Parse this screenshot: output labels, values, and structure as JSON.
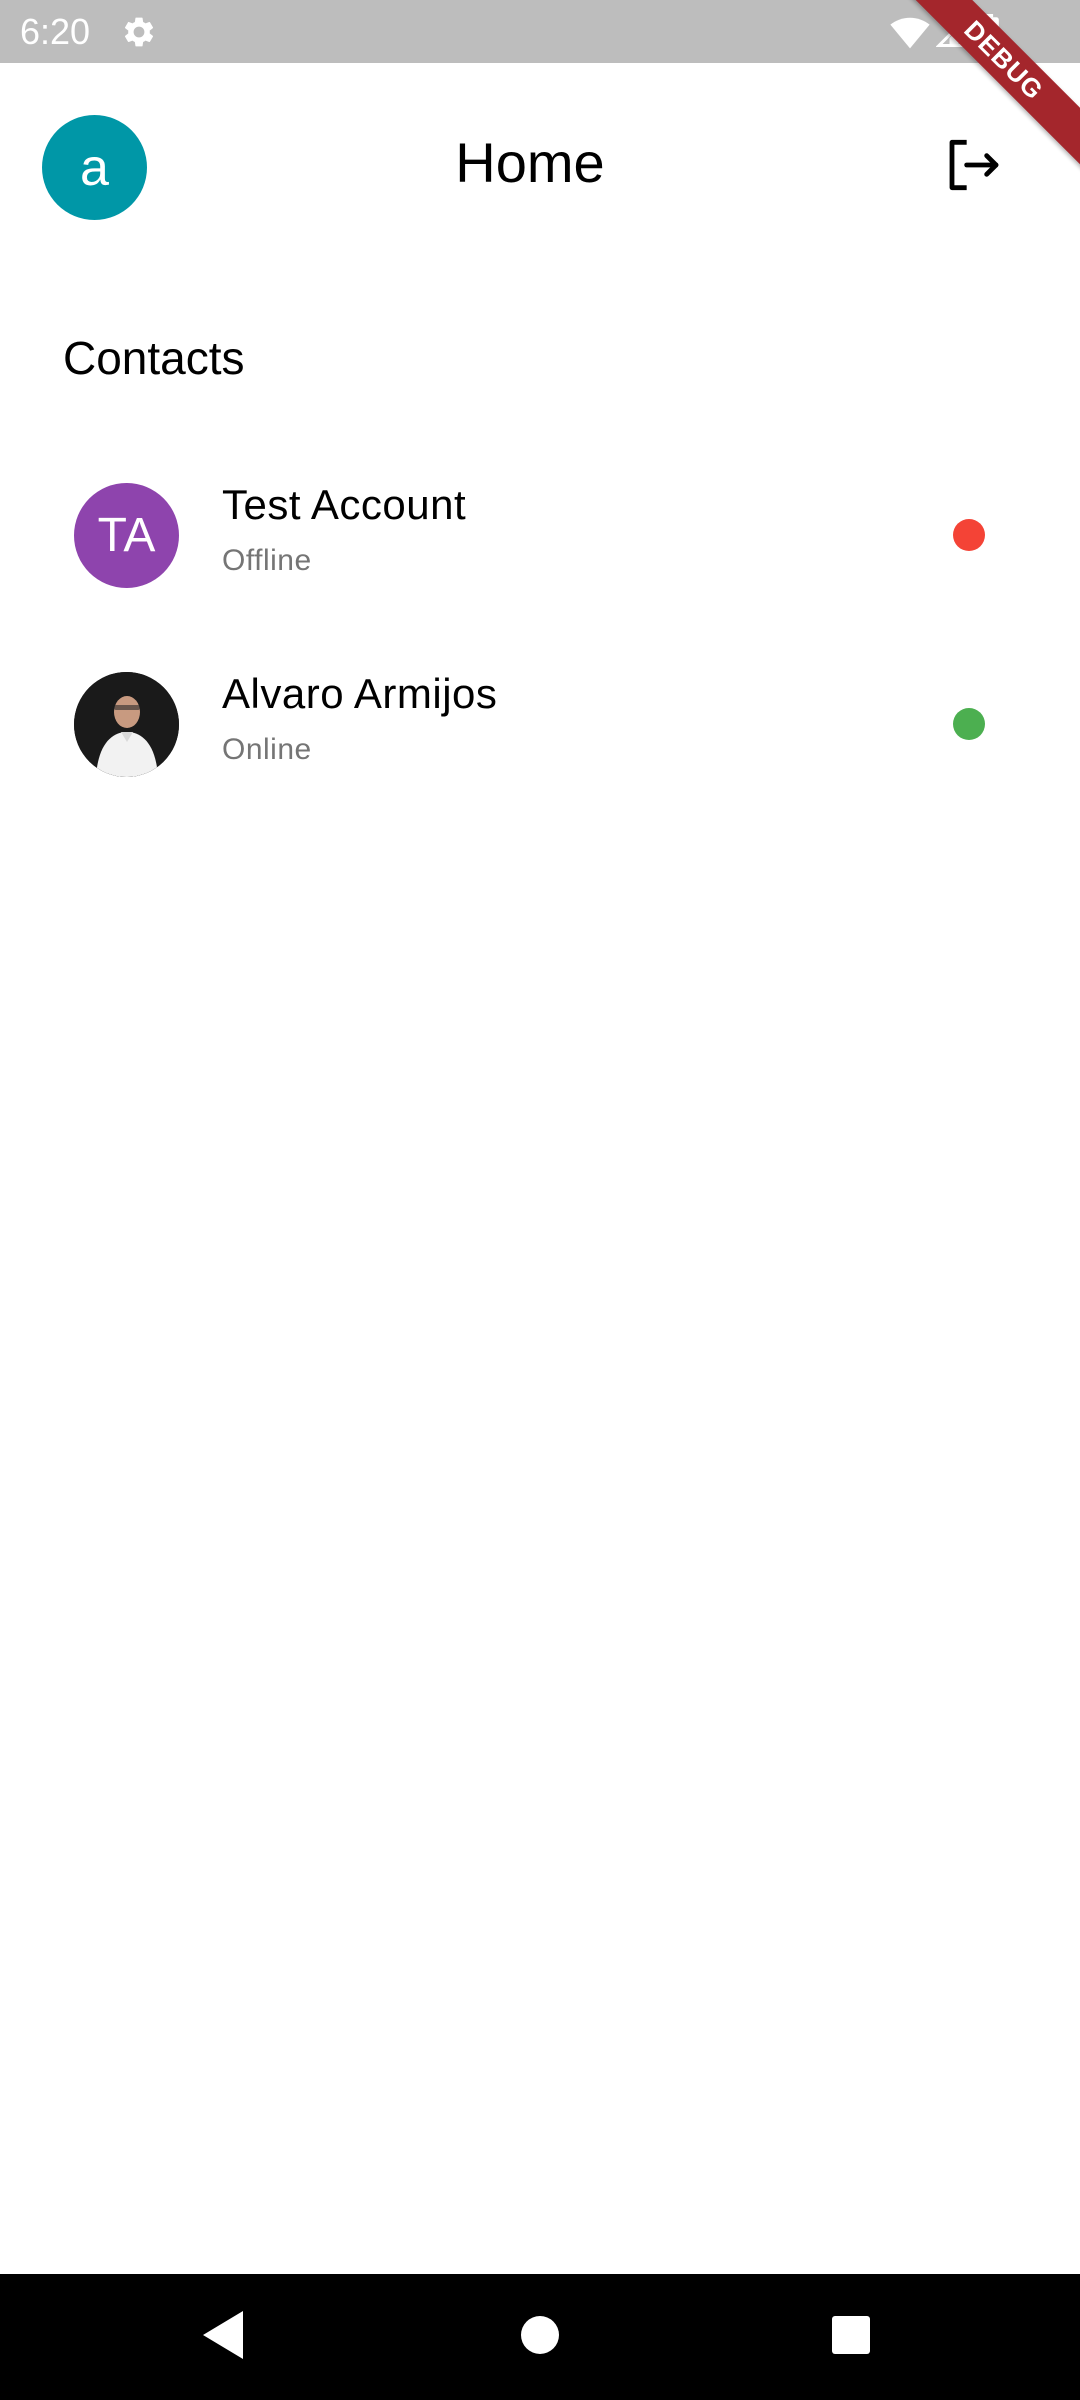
{
  "status_bar": {
    "time": "6:20",
    "icons": [
      "gear-icon",
      "wifi-icon",
      "signal-icon",
      "battery-icon"
    ]
  },
  "debug_banner": "DEBUG",
  "app_bar": {
    "profile_initial": "a",
    "title": "Home",
    "profile_color": "#0097a7",
    "logout_icon": "logout-icon"
  },
  "contacts": {
    "title": "Contacts",
    "items": [
      {
        "name": "Test Account",
        "status": "Offline",
        "avatar_initials": "TA",
        "avatar_color": "#8e44ad",
        "status_color": "#f44336"
      },
      {
        "name": "Alvaro Armijos",
        "status": "Online",
        "avatar_image": "person-photo",
        "status_color": "#4caf50"
      }
    ]
  },
  "nav_bar": {
    "buttons": [
      "back-icon",
      "home-icon",
      "recents-icon"
    ]
  }
}
